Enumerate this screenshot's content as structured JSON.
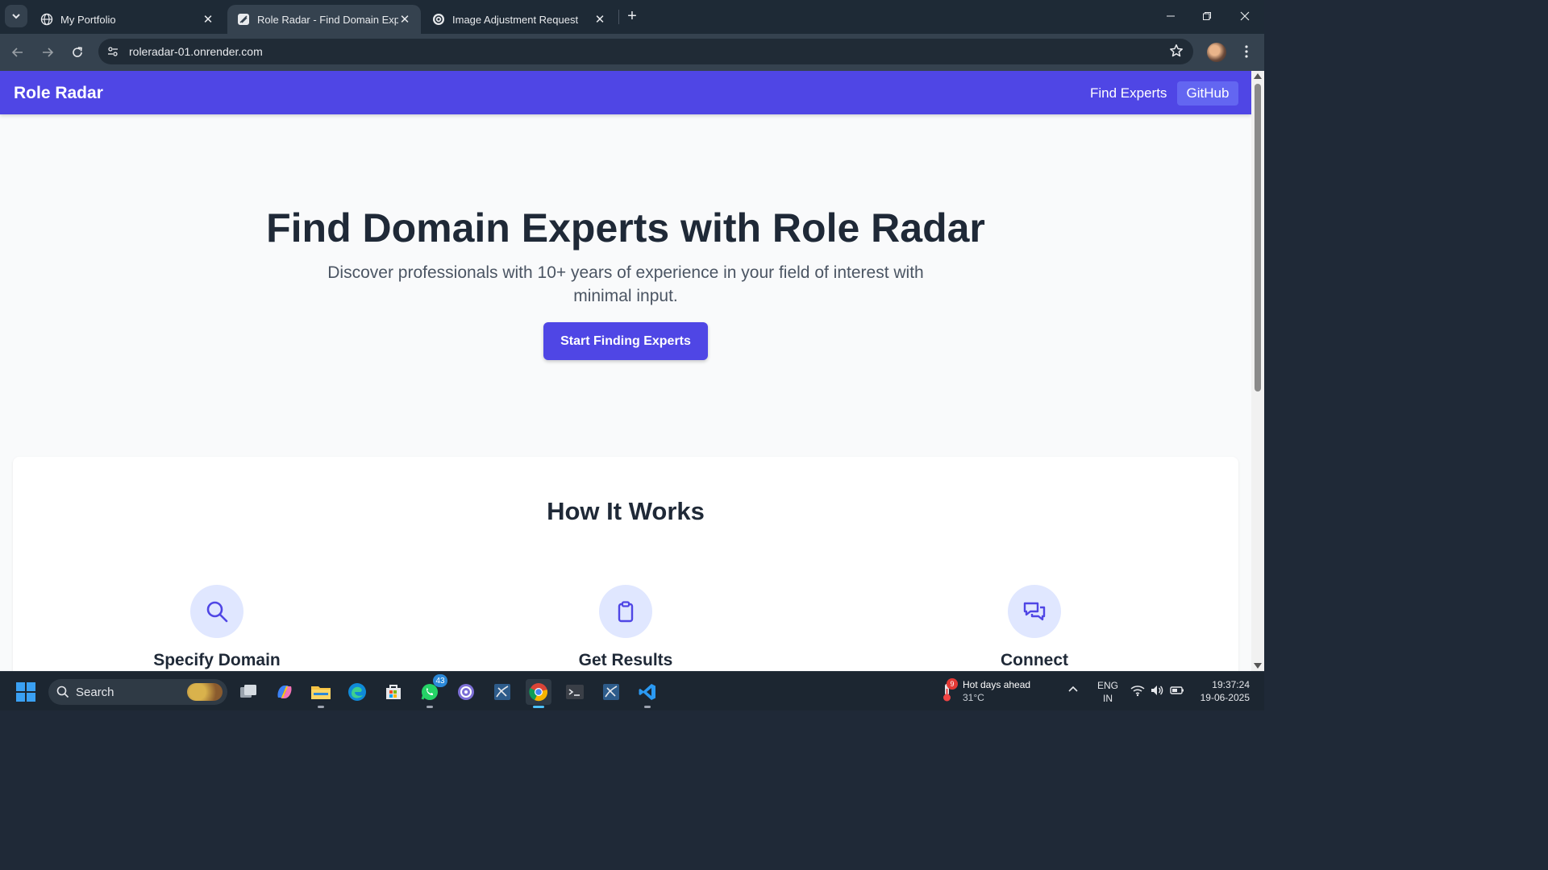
{
  "browser": {
    "tabs": [
      {
        "title": "My Portfolio",
        "icon": "globe-icon"
      },
      {
        "title": "Role Radar - Find Domain Experts",
        "icon": "site-favicon-icon"
      },
      {
        "title": "Image Adjustment Request",
        "icon": "chatgpt-icon"
      }
    ],
    "active_tab_index": 1,
    "url": "roleradar-01.onrender.com"
  },
  "site": {
    "brand": "Role Radar",
    "nav": {
      "find_experts": "Find Experts",
      "github": "GitHub"
    },
    "hero": {
      "title": "Find Domain Experts with Role Radar",
      "subtitle": "Discover professionals with 10+ years of experience in your field of interest with minimal input.",
      "cta": "Start Finding Experts"
    },
    "how_it_works": {
      "title": "How It Works",
      "steps": [
        {
          "label": "Specify Domain",
          "icon": "search-icon"
        },
        {
          "label": "Get Results",
          "icon": "clipboard-icon"
        },
        {
          "label": "Connect",
          "icon": "chat-bubbles-icon"
        }
      ]
    },
    "colors": {
      "primary": "#4f46e5",
      "primary_light": "#e0e7ff",
      "text_dark": "#1f2937"
    }
  },
  "taskbar": {
    "search_label": "Search",
    "whatsapp_badge": "43",
    "weather": {
      "headline": "Hot days ahead",
      "temp": "31°C",
      "alert_count": "9"
    },
    "language": {
      "line1": "ENG",
      "line2": "IN"
    },
    "time": "19:37:24",
    "date": "19-06-2025"
  }
}
